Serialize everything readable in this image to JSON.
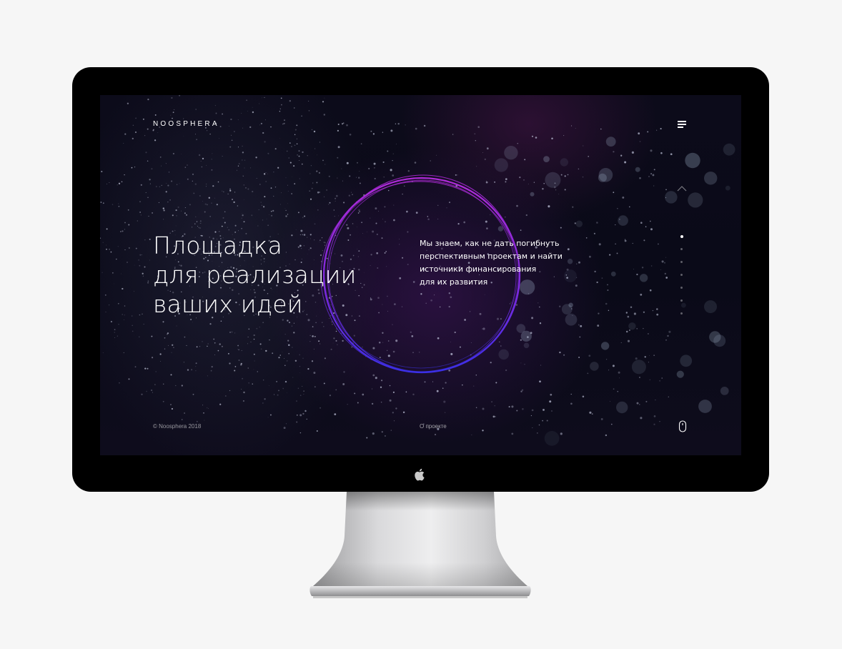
{
  "brand": {
    "logo_text": "NOOSPHERA"
  },
  "hero": {
    "headline_lines": [
      "Площадка",
      "для реализации",
      "ваших идей"
    ],
    "description_lines": [
      "Мы знаем, как не дать погибнуть",
      "перспективным проектам и найти",
      "источники финансирования",
      "для их развития"
    ]
  },
  "footer": {
    "copyright": "© Noosphera 2018",
    "about_link": "О проекте"
  },
  "navigation": {
    "slide_count": 6,
    "active_slide": 1
  },
  "icons": {
    "menu": "hamburger-menu-icon",
    "up": "chevron-up-icon",
    "scroll": "mouse-scroll-icon",
    "device_logo": "apple-logo-icon"
  },
  "colors": {
    "page_background": "#f6f6f6",
    "bezel": "#000000",
    "screen_background": "#0b0a18",
    "ring_gradient_start": "#a42ad6",
    "ring_gradient_end": "#3a2de0",
    "text": "#ffffff"
  }
}
